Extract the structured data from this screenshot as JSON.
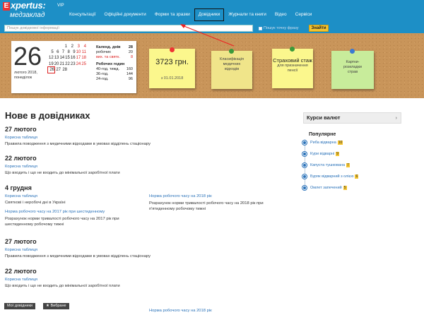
{
  "header": {
    "logo_mark": "E",
    "logo_main": "xpertus:",
    "logo_sub": "медзаклад",
    "logo_badge": "VIP",
    "nav": [
      {
        "label": "Консультації"
      },
      {
        "label": "Офіційні документи"
      },
      {
        "label": "Форми та зразки"
      },
      {
        "label": "Довідники",
        "active": true
      },
      {
        "label": "Журнали та книги"
      },
      {
        "label": "Відео"
      },
      {
        "label": "Сервіси"
      }
    ]
  },
  "search": {
    "placeholder": "Пошук довідкової інформації",
    "exact_phrase_label": "Пошук точну фразу",
    "button_label": "Знайти"
  },
  "calendar": {
    "day": "26",
    "date_line1": "лютого 2018,",
    "date_line2": "понеділок",
    "rows": [
      [
        "",
        "",
        "1",
        "2",
        "3",
        "4"
      ],
      [
        "5",
        "6",
        "7",
        "8",
        "9",
        "10",
        "11"
      ],
      [
        "12",
        "13",
        "14",
        "15",
        "16",
        "17",
        "18"
      ],
      [
        "19",
        "20",
        "21",
        "22",
        "23",
        "24",
        "25"
      ],
      [
        "26",
        "27",
        "28"
      ]
    ],
    "info": {
      "cal_header": "Календ. днів",
      "cal_days": "28",
      "working_label": "робочих",
      "working_days": "20",
      "off_label": "вих. та святк.",
      "off_days": "8",
      "hours_header": "Робочих годин",
      "h40_label": "40-год. тижд.",
      "h40": "160",
      "h36_label": "36-год.",
      "h36": "144",
      "h24_label": "24-год.",
      "h24": "96"
    }
  },
  "stickies": {
    "s1_big": "3723 грн.",
    "s1_small": "з 01.01.2018",
    "s2_line1": "Класифікація",
    "s2_line2": "медичних",
    "s2_line3": "відходів",
    "s3_line1": "Страховий стаж",
    "s3_sub1": "для призначення",
    "s3_sub2": "пенсії",
    "s4_line1": "Картки-",
    "s4_line2": "розкладки",
    "s4_line3": "страв"
  },
  "main": {
    "title": "Нове в довідниках",
    "entries": [
      {
        "date": "27 лютого",
        "category": "Корисна таблиця",
        "text": "Правила поводження з медичними відходами в умовах відділень стаціонару"
      },
      {
        "date": "22 лютого",
        "category": "Корисна таблиця",
        "text": "Що входить і що не входить до мінімальної заробітної плати"
      },
      {
        "date": "4 грудня",
        "category": "Корисна таблиця",
        "text": "Святкові і неробочі дні в Україні",
        "link2": "Норма робочого часу на 2017 рік при шестиденному",
        "text2a": "Розрахунок норми тривалості робочого часу на 2017 рік при",
        "text2b": "шестиденному робочому тижні",
        "right_link": "Норма робочого часу на 2018 рік",
        "right_text_a": "Розрахунок норми тривалості робочого часу на 2018 рік при",
        "right_text_b": "п'ятиденному робочому тижні"
      },
      {
        "date": "27 лютого",
        "category": "Корисна таблиця",
        "text": "Правила поводження з медичними відходами в умовах відділень стаціонару"
      },
      {
        "date": "22 лютого",
        "category": "Корисна таблиця",
        "text": "Що входить і що не входить до мінімальної заробітної плати",
        "right_link": "Норма робочого часу на 2018 рік"
      }
    ]
  },
  "sidebar": {
    "rates_label": "Курси валют",
    "popular_title": "Популярне",
    "popular": [
      {
        "label": "Риба відварна",
        "count": "10"
      },
      {
        "label": "Кури відварні",
        "count": "9"
      },
      {
        "label": "Капуста тушкована",
        "count": "7"
      },
      {
        "label": "Буряк відварний з олією",
        "count": "6"
      },
      {
        "label": "Омлет запечений",
        "count": "5"
      }
    ]
  },
  "bottom": {
    "my_refs": "Мої довідники",
    "favorites": "★ Вибране"
  }
}
